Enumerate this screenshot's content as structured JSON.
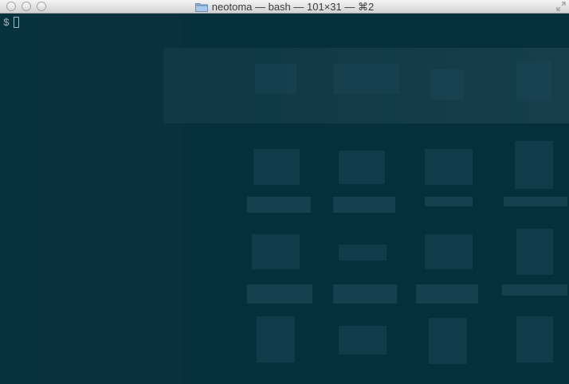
{
  "window": {
    "title": "neotoma — bash — 101×31 — ⌘2",
    "title_icon": "folder-icon",
    "controls": [
      "close-button",
      "minimize-button",
      "zoom-button"
    ],
    "fullscreen_icon": "fullscreen-icon"
  },
  "terminal": {
    "prompt": "$",
    "background_color": "#062f3c",
    "text_color": "#9fb6bd"
  }
}
